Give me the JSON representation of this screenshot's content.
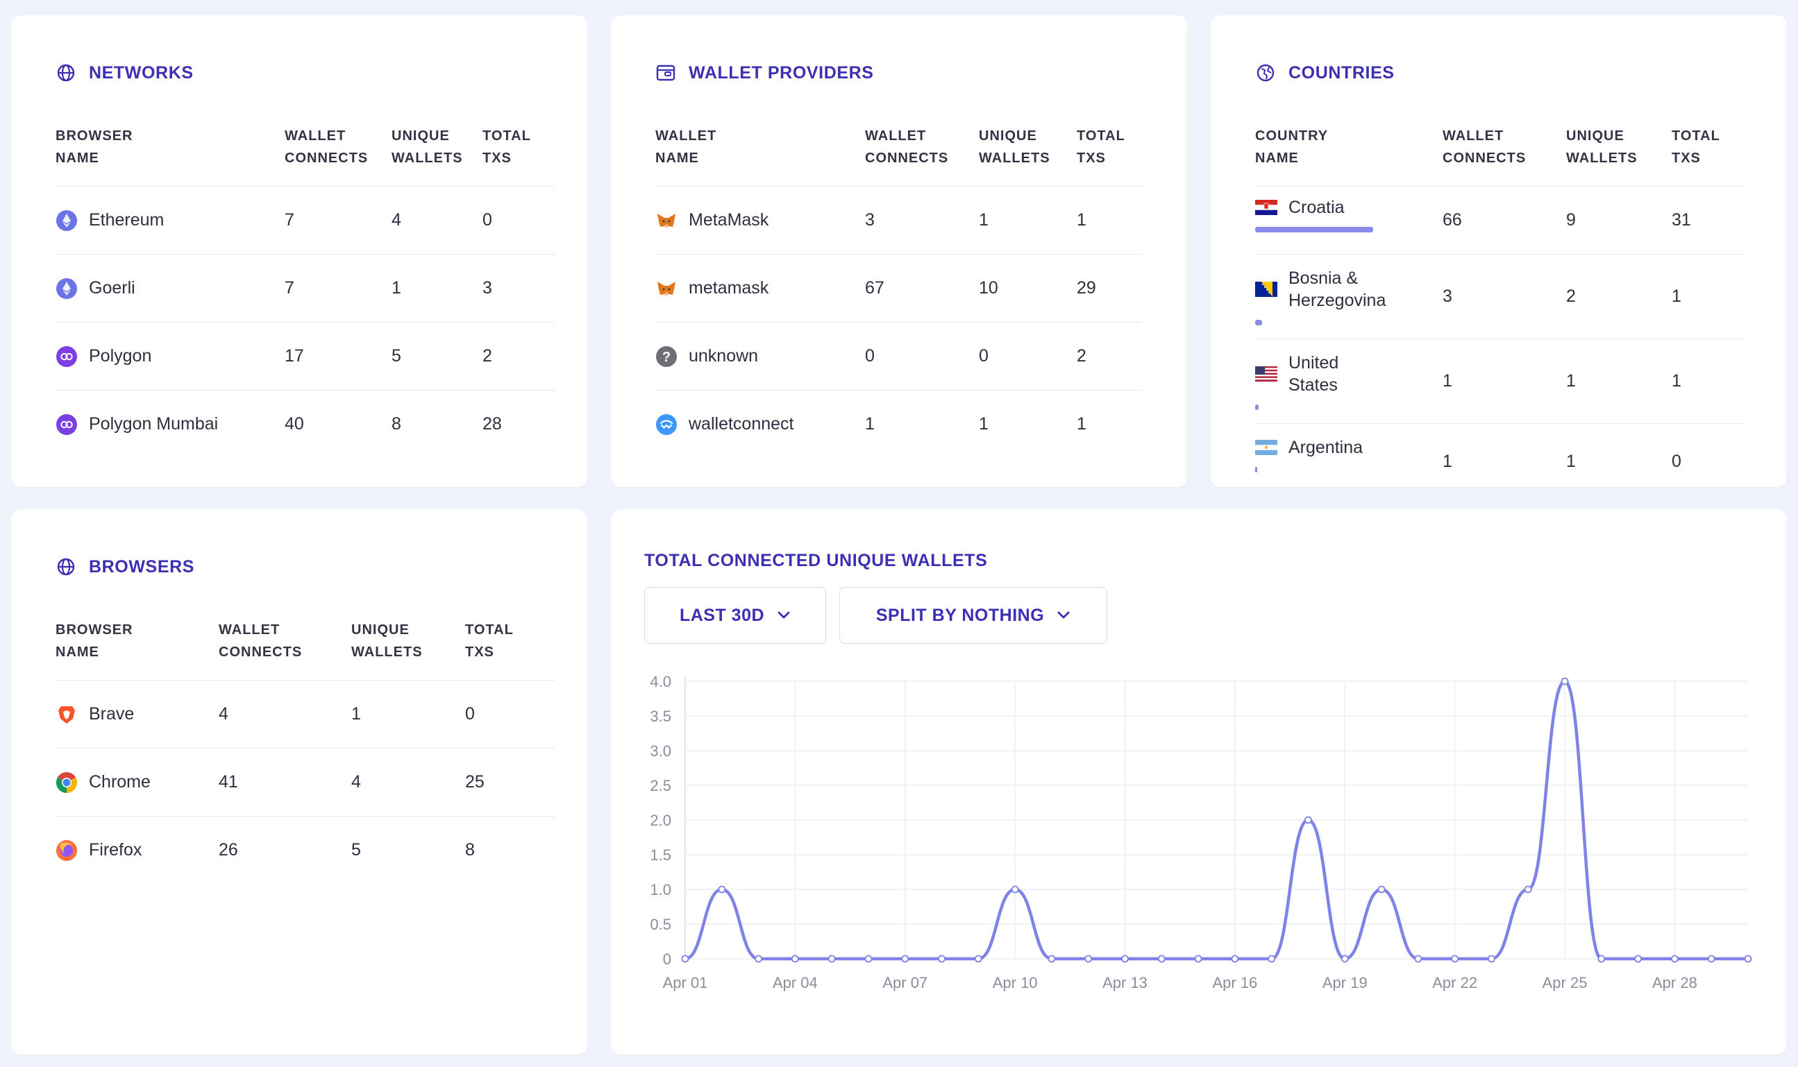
{
  "networks": {
    "title": "NETWORKS",
    "headers": [
      "BROWSER\nNAME",
      "WALLET\nCONNECTS",
      "UNIQUE\nWALLETS",
      "TOTAL\nTXS"
    ],
    "rows": [
      {
        "name": "Ethereum",
        "connects": "7",
        "unique": "4",
        "txs": "0",
        "icon": "ethereum-icon"
      },
      {
        "name": "Goerli",
        "connects": "7",
        "unique": "1",
        "txs": "3",
        "icon": "ethereum-icon"
      },
      {
        "name": "Polygon",
        "connects": "17",
        "unique": "5",
        "txs": "2",
        "icon": "polygon-icon"
      },
      {
        "name": "Polygon Mumbai",
        "connects": "40",
        "unique": "8",
        "txs": "28",
        "icon": "polygon-icon"
      }
    ]
  },
  "wallet_providers": {
    "title": "WALLET PROVIDERS",
    "headers": [
      "WALLET\nNAME",
      "WALLET\nCONNECTS",
      "UNIQUE\nWALLETS",
      "TOTAL\nTXS"
    ],
    "rows": [
      {
        "name": "MetaMask",
        "connects": "3",
        "unique": "1",
        "txs": "1",
        "icon": "metamask-fox-icon"
      },
      {
        "name": "metamask",
        "connects": "67",
        "unique": "10",
        "txs": "29",
        "icon": "metamask-fox-icon"
      },
      {
        "name": "unknown",
        "connects": "0",
        "unique": "0",
        "txs": "2",
        "icon": "question-icon"
      },
      {
        "name": "walletconnect",
        "connects": "1",
        "unique": "1",
        "txs": "1",
        "icon": "walletconnect-icon"
      }
    ]
  },
  "countries": {
    "title": "COUNTRIES",
    "headers": [
      "COUNTRY\nNAME",
      "WALLET\nCONNECTS",
      "UNIQUE\nWALLETS",
      "TOTAL\nTXS"
    ],
    "rows": [
      {
        "name": "Croatia",
        "connects": "66",
        "unique": "9",
        "txs": "31",
        "icon": "croatia-flag-icon",
        "share": 1.0
      },
      {
        "name": "Bosnia & Herzegovina",
        "connects": "3",
        "unique": "2",
        "txs": "1",
        "icon": "bosnia-flag-icon",
        "share": 0.06
      },
      {
        "name": "United States",
        "connects": "1",
        "unique": "1",
        "txs": "1",
        "icon": "us-flag-icon",
        "share": 0.03
      },
      {
        "name": "Argentina",
        "connects": "1",
        "unique": "1",
        "txs": "0",
        "icon": "argentina-flag-icon",
        "share": 0.02
      }
    ]
  },
  "browsers": {
    "title": "BROWSERS",
    "headers": [
      "BROWSER\nNAME",
      "WALLET\nCONNECTS",
      "UNIQUE\nWALLETS",
      "TOTAL\nTXS"
    ],
    "rows": [
      {
        "name": "Brave",
        "connects": "4",
        "unique": "1",
        "txs": "0",
        "icon": "brave-icon"
      },
      {
        "name": "Chrome",
        "connects": "41",
        "unique": "4",
        "txs": "25",
        "icon": "chrome-icon"
      },
      {
        "name": "Firefox",
        "connects": "26",
        "unique": "5",
        "txs": "8",
        "icon": "firefox-icon"
      }
    ]
  },
  "wallets_chart": {
    "title": "TOTAL CONNECTED UNIQUE WALLETS",
    "range_button": "LAST 30D",
    "split_button": "SPLIT BY NOTHING"
  },
  "colors": {
    "accent": "#3c2fb3",
    "line": "#7f82e6",
    "bar": "#8a8be8"
  },
  "chart_data": {
    "type": "line",
    "title": "TOTAL CONNECTED UNIQUE WALLETS",
    "xlabel": "",
    "ylabel": "",
    "ylim": [
      0,
      4
    ],
    "yticks": [
      "0",
      "0.5",
      "1.0",
      "1.5",
      "2.0",
      "2.5",
      "3.0",
      "3.5",
      "4.0"
    ],
    "xtick_labels": [
      "Apr 01",
      "Apr 04",
      "Apr 07",
      "Apr 10",
      "Apr 13",
      "Apr 16",
      "Apr 19",
      "Apr 22",
      "Apr 25",
      "Apr 28"
    ],
    "x": [
      "Apr 01",
      "Apr 02",
      "Apr 03",
      "Apr 04",
      "Apr 05",
      "Apr 06",
      "Apr 07",
      "Apr 08",
      "Apr 09",
      "Apr 10",
      "Apr 11",
      "Apr 12",
      "Apr 13",
      "Apr 14",
      "Apr 15",
      "Apr 16",
      "Apr 17",
      "Apr 18",
      "Apr 19",
      "Apr 20",
      "Apr 21",
      "Apr 22",
      "Apr 23",
      "Apr 24",
      "Apr 25",
      "Apr 26",
      "Apr 27",
      "Apr 28",
      "Apr 29",
      "Apr 30"
    ],
    "series": [
      {
        "values": [
          0,
          1,
          0,
          0,
          0,
          0,
          0,
          0,
          0,
          1,
          0,
          0,
          0,
          0,
          0,
          0,
          0,
          2,
          0,
          1,
          0,
          0,
          0,
          1,
          4,
          0,
          0,
          0,
          0,
          0
        ]
      }
    ],
    "grid": true
  }
}
